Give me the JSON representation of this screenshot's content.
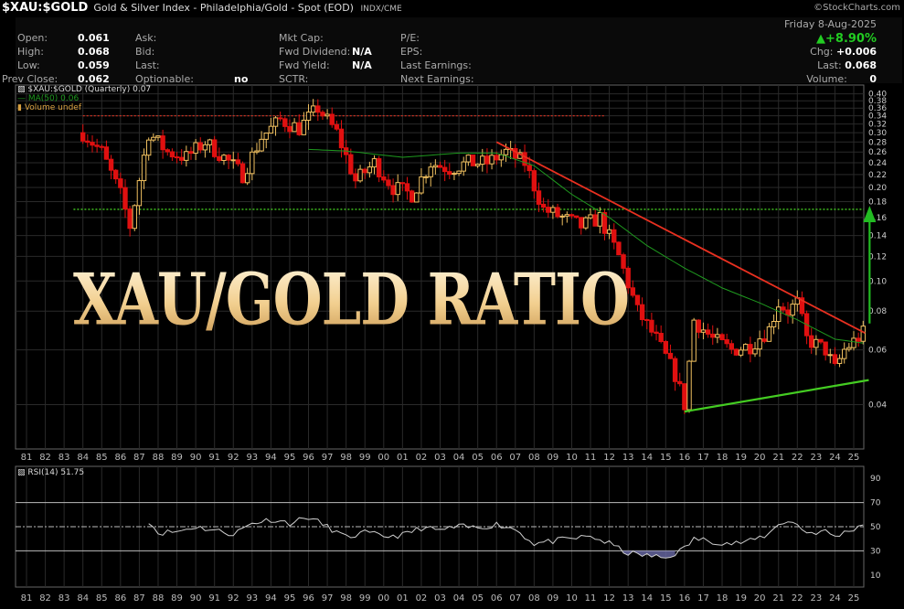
{
  "header": {
    "symbol": "$XAU:$GOLD",
    "description": "Gold & Silver Index - Philadelphia/Gold - Spot (EOD)",
    "exchange": "INDX/CME",
    "source": "©StockCharts.com"
  },
  "quote": {
    "open_label": "Open:",
    "open": "0.061",
    "high_label": "High:",
    "high": "0.068",
    "low_label": "Low:",
    "low": "0.059",
    "prevclose_label": "Prev Close:",
    "prevclose": "0.062",
    "ask_label": "Ask:",
    "bid_label": "Bid:",
    "last_label": "Last:",
    "optionable_label": "Optionable:",
    "optionable": "no",
    "mktcap_label": "Mkt Cap:",
    "fwddiv_label": "Fwd Dividend:",
    "fwddiv": "N/A",
    "fwdyield_label": "Fwd Yield:",
    "fwdyield": "N/A",
    "sctr_label": "SCTR:",
    "pe_label": "P/E:",
    "eps_label": "EPS:",
    "lastearn_label": "Last Earnings:",
    "nextearn_label": "Next Earnings:",
    "date": "Friday  8-Aug-2025",
    "change": "+8.90%",
    "chg_label": "Chg:",
    "chg": "+0.006",
    "last2_label": "Last:",
    "last2": "0.068",
    "volume_label": "Volume:",
    "volume": "0"
  },
  "legend": {
    "main": "$XAU:$GOLD (Quarterly) 0.07",
    "ma": "MA(50) 0.06",
    "vol": "Volume undef"
  },
  "overlay_text": "XAU/GOLD RATIO",
  "colors": {
    "up": "#f0c060",
    "down": "#e01010",
    "ma": "#1f9a1f",
    "resistance": "#e83020",
    "support": "#44cc22",
    "target": "#22bb22",
    "dotted_red": "#d03020"
  },
  "chart_data": [
    {
      "type": "candlestick",
      "scale": "log",
      "y_ticks": [
        "0.40",
        "0.38",
        "0.36",
        "0.34",
        "0.32",
        "0.30",
        "0.28",
        "0.26",
        "0.24",
        "0.22",
        "0.20",
        "0.18",
        "0.16",
        "0.14",
        "0.12",
        "0.10",
        "0.08",
        "0.06",
        "0.04"
      ],
      "x_ticks": [
        "81",
        "82",
        "83",
        "84",
        "85",
        "86",
        "87",
        "88",
        "89",
        "90",
        "91",
        "92",
        "93",
        "94",
        "95",
        "96",
        "97",
        "98",
        "99",
        "00",
        "01",
        "02",
        "03",
        "04",
        "05",
        "06",
        "07",
        "08",
        "09",
        "10",
        "11",
        "12",
        "13",
        "14",
        "15",
        "16",
        "17",
        "18",
        "19",
        "20",
        "21",
        "22",
        "23",
        "24",
        "25"
      ],
      "x_range": [
        1981,
        2025.75
      ],
      "ylim": [
        0.03,
        0.41
      ],
      "series": [
        {
          "name": "$XAU:$GOLD (Quarterly) 0.07",
          "anchors": [
            [
              1984.0,
              0.3
            ],
            [
              1985.0,
              0.26
            ],
            [
              1986.0,
              0.19
            ],
            [
              1986.5,
              0.15
            ],
            [
              1987.5,
              0.3
            ],
            [
              1988.5,
              0.26
            ],
            [
              1989.5,
              0.25
            ],
            [
              1990.5,
              0.28
            ],
            [
              1991.5,
              0.25
            ],
            [
              1992.5,
              0.22
            ],
            [
              1993.5,
              0.29
            ],
            [
              1994.5,
              0.33
            ],
            [
              1995.5,
              0.31
            ],
            [
              1996.5,
              0.36
            ],
            [
              1997.5,
              0.3
            ],
            [
              1998.5,
              0.21
            ],
            [
              1999.5,
              0.24
            ],
            [
              2000.5,
              0.2
            ],
            [
              2001.5,
              0.19
            ],
            [
              2002.5,
              0.24
            ],
            [
              2003.5,
              0.23
            ],
            [
              2004.5,
              0.24
            ],
            [
              2005.5,
              0.24
            ],
            [
              2006.5,
              0.26
            ],
            [
              2007.5,
              0.24
            ],
            [
              2008.5,
              0.17
            ],
            [
              2009.5,
              0.16
            ],
            [
              2010.5,
              0.15
            ],
            [
              2011.5,
              0.16
            ],
            [
              2012.5,
              0.12
            ],
            [
              2013.5,
              0.08
            ],
            [
              2014.5,
              0.065
            ],
            [
              2015.5,
              0.05
            ],
            [
              2016.0,
              0.04
            ],
            [
              2016.5,
              0.075
            ],
            [
              2017.5,
              0.065
            ],
            [
              2018.5,
              0.06
            ],
            [
              2019.5,
              0.062
            ],
            [
              2020.5,
              0.07
            ],
            [
              2021.0,
              0.085
            ],
            [
              2021.5,
              0.08
            ],
            [
              2022.0,
              0.085
            ],
            [
              2022.5,
              0.065
            ],
            [
              2023.5,
              0.06
            ],
            [
              2024.0,
              0.052
            ],
            [
              2024.5,
              0.06
            ],
            [
              2025.5,
              0.068
            ]
          ]
        },
        {
          "name": "MA(50) 0.06",
          "anchors": [
            [
              1996.0,
              0.265
            ],
            [
              1998.0,
              0.262
            ],
            [
              2001.0,
              0.25
            ],
            [
              2004.0,
              0.258
            ],
            [
              2006.0,
              0.258
            ],
            [
              2008.0,
              0.235
            ],
            [
              2010.0,
              0.19
            ],
            [
              2012.0,
              0.16
            ],
            [
              2014.0,
              0.13
            ],
            [
              2016.0,
              0.11
            ],
            [
              2018.0,
              0.095
            ],
            [
              2020.0,
              0.085
            ],
            [
              2022.0,
              0.075
            ],
            [
              2024.0,
              0.065
            ],
            [
              2025.6,
              0.063
            ]
          ]
        }
      ],
      "annotations": {
        "resistance_line": [
          [
            2006.0,
            0.28
          ],
          [
            2025.6,
            0.068
          ]
        ],
        "support_line": [
          [
            2016.0,
            0.038
          ],
          [
            2025.8,
            0.048
          ]
        ],
        "dotted_red_level": 0.34,
        "dotted_green_level": 0.17,
        "target_arrow": {
          "x": 2025.6,
          "from": 0.073,
          "to": 0.17
        }
      }
    },
    {
      "type": "line",
      "title": "RSI(14) 51.75",
      "ylim": [
        0,
        100
      ],
      "y_ticks": [
        "90",
        "70",
        "50",
        "30",
        "10"
      ],
      "levels": [
        70,
        50,
        30
      ],
      "series": [
        {
          "name": "RSI(14) 51.75",
          "anchors": [
            [
              1987.5,
              55
            ],
            [
              1988.0,
              45
            ],
            [
              1989.0,
              46
            ],
            [
              1990.0,
              50
            ],
            [
              1991.0,
              47
            ],
            [
              1992.0,
              44
            ],
            [
              1993.0,
              53
            ],
            [
              1994.0,
              56
            ],
            [
              1995.0,
              53
            ],
            [
              1996.0,
              58
            ],
            [
              1997.0,
              50
            ],
            [
              1998.0,
              41
            ],
            [
              1999.0,
              45
            ],
            [
              2000.0,
              42
            ],
            [
              2001.0,
              43
            ],
            [
              2002.0,
              49
            ],
            [
              2003.0,
              47
            ],
            [
              2004.0,
              50
            ],
            [
              2005.0,
              49
            ],
            [
              2006.0,
              52
            ],
            [
              2007.0,
              48
            ],
            [
              2008.0,
              36
            ],
            [
              2009.0,
              38
            ],
            [
              2010.0,
              40
            ],
            [
              2011.0,
              42
            ],
            [
              2012.0,
              36
            ],
            [
              2013.0,
              28
            ],
            [
              2014.0,
              26
            ],
            [
              2015.0,
              24
            ],
            [
              2016.0,
              32
            ],
            [
              2016.5,
              40
            ],
            [
              2017.5,
              38
            ],
            [
              2018.5,
              36
            ],
            [
              2019.5,
              38
            ],
            [
              2020.5,
              44
            ],
            [
              2021.0,
              53
            ],
            [
              2021.5,
              54
            ],
            [
              2022.0,
              52
            ],
            [
              2022.5,
              45
            ],
            [
              2023.5,
              46
            ],
            [
              2024.0,
              42
            ],
            [
              2024.5,
              45
            ],
            [
              2025.5,
              52
            ]
          ]
        }
      ]
    }
  ]
}
